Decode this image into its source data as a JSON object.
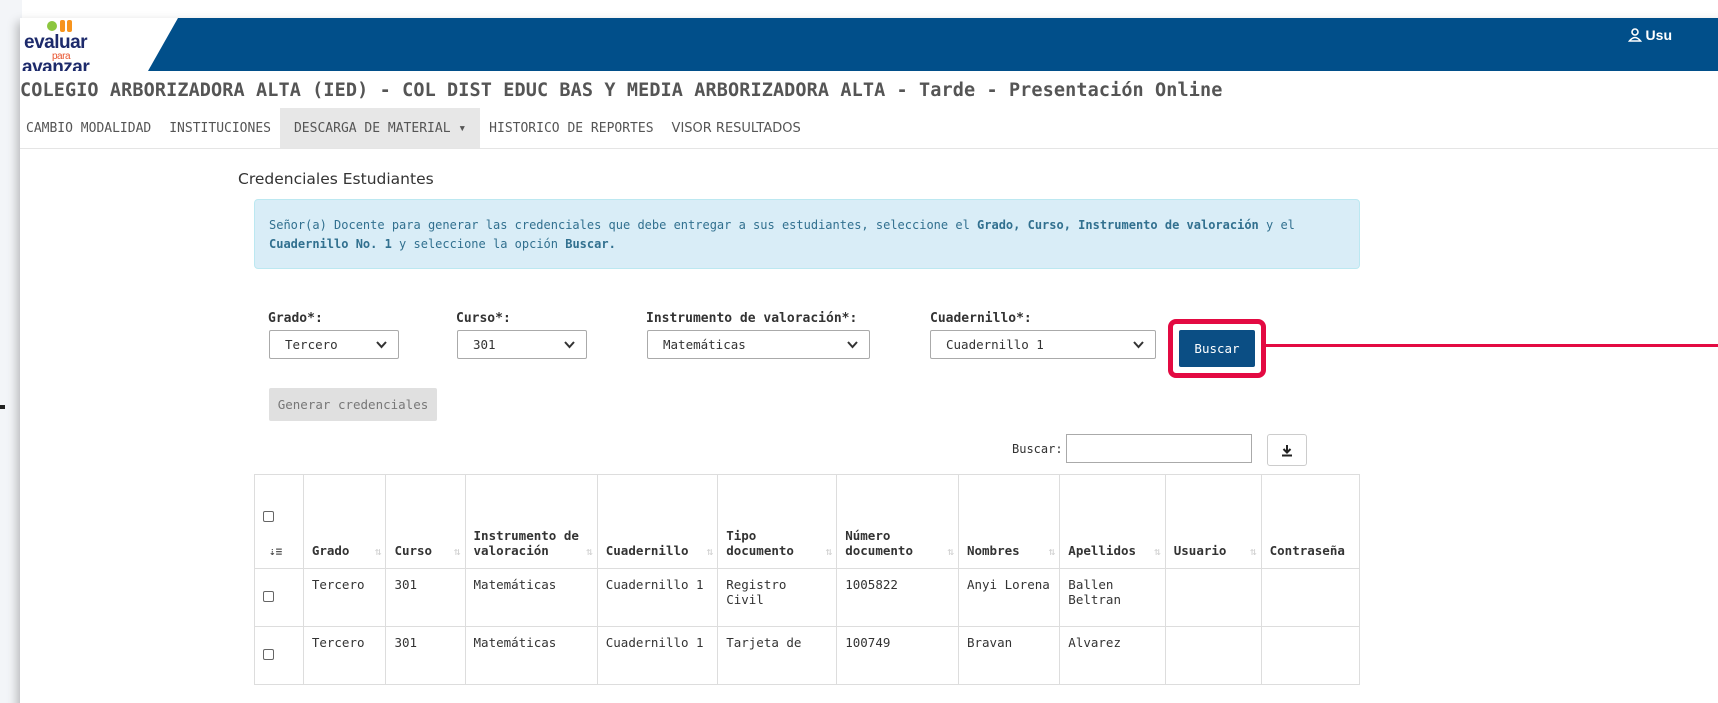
{
  "header": {
    "logo": {
      "line1": "evaluar",
      "line2": "para",
      "line3": "avanzar"
    },
    "user_label": "Usu",
    "user_icon": "user-icon"
  },
  "institution_title": "COLEGIO ARBORIZADORA ALTA (IED) - COL DIST EDUC BAS Y MEDIA ARBORIZADORA ALTA - Tarde - Presentación Online",
  "nav": [
    {
      "label": "CAMBIO MODALIDAD"
    },
    {
      "label": "INSTITUCIONES"
    },
    {
      "label": "DESCARGA DE MATERIAL ▾",
      "active": true
    },
    {
      "label": "HISTORICO DE REPORTES"
    },
    {
      "label": "VISOR RESULTADOS"
    }
  ],
  "page_heading": "Credenciales Estudiantes",
  "info": {
    "t1": "Señor(a) Docente para generar las credenciales que debe entregar a sus estudiantes, seleccione el ",
    "b1": "Grado, Curso, Instrumento de valoración",
    "t2": " y el",
    "b2": "Cuadernillo No. 1",
    "t3": " y seleccione la opción ",
    "b3": "Buscar."
  },
  "filters": {
    "grado": {
      "label": "Grado*:",
      "value": "Tercero"
    },
    "curso": {
      "label": "Curso*:",
      "value": "301"
    },
    "instrumento": {
      "label": "Instrumento de valoración*:",
      "value": "Matemáticas"
    },
    "cuadernillo": {
      "label": "Cuadernillo*:",
      "value": "Cuadernillo 1"
    },
    "buscar_label": "Buscar"
  },
  "generate_label": "Generar credenciales",
  "table_search": {
    "label": "Buscar:",
    "value": "",
    "download_icon": "download-icon"
  },
  "table": {
    "columns": [
      "Grado",
      "Curso",
      "Instrumento de valoración",
      "Cuadernillo",
      "Tipo documento",
      "Número documento",
      "Nombres",
      "Apellidos",
      "Usuario",
      "Contraseña"
    ],
    "rows": [
      [
        "Tercero",
        "301",
        "Matemáticas",
        "Cuadernillo 1",
        "Registro Civil",
        "1005822",
        "Anyi Lorena",
        "Ballen Beltran",
        "",
        ""
      ],
      [
        "Tercero",
        "301",
        "Matemáticas",
        "Cuadernillo 1",
        "Tarjeta de",
        "100749",
        "Bravan",
        "Alvarez",
        "",
        ""
      ]
    ]
  },
  "colors": {
    "header_bg": "#014f8a",
    "highlight": "#e30a42",
    "primary_button": "#0b4e84",
    "info_bg": "#d9edf7"
  }
}
